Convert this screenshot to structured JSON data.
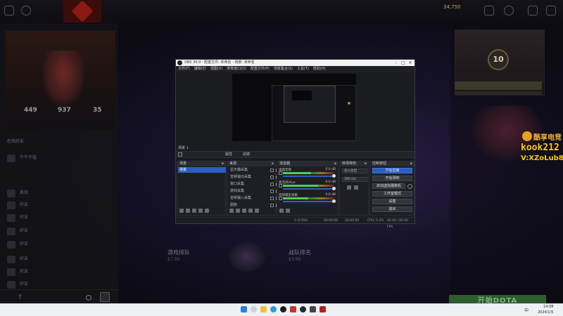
{
  "dota": {
    "gold": "34,750",
    "profile": {
      "name": "emt",
      "stats": [
        {
          "value": "449"
        },
        {
          "value": "937"
        },
        {
          "value": "35"
        }
      ]
    },
    "friends_header": "在线好友",
    "friends": [
      {
        "name": "牛牛不猛"
      },
      {
        "name": "离线"
      },
      {
        "name": "好友"
      },
      {
        "name": "好友"
      },
      {
        "name": "好友"
      },
      {
        "name": "好友"
      },
      {
        "name": "好友"
      },
      {
        "name": "好友"
      },
      {
        "name": "好友"
      }
    ],
    "right_level": "10",
    "promo_left_title": "游戏排队",
    "promo_left_value": "$7.99",
    "promo_right_title": "战队排名",
    "promo_right_value": "$3.99",
    "play_button": "开始DOTA"
  },
  "watermark": {
    "brand": "酷享电竞",
    "line1": "kook212",
    "line2": "V:XZoLub812"
  },
  "obs": {
    "title": "OBS 30.0 - 配置文件: 未命名 - 场景: 未命名",
    "menu": [
      "文件(F)",
      "编辑(E)",
      "视图(V)",
      "停靠窗口(D)",
      "配置文件(P)",
      "场景集合(S)",
      "工具(T)",
      "帮助(H)"
    ],
    "scene_label": "场景 1",
    "toolbar": {
      "properties": "属性",
      "filters": "滤镜"
    },
    "docks": {
      "scenes": "场景",
      "sources": "来源",
      "mixer": "混音器",
      "transitions": "转场特效",
      "controls": "控制按钮"
    },
    "scene_selected": "场景",
    "sources": [
      "显示器采集",
      "音频输出采集",
      "窗口采集",
      "游戏采集",
      "音频输入采集",
      "图像"
    ],
    "mixer": [
      {
        "name": "桌面音频",
        "db": "0.0 dB",
        "level": 0.55
      },
      {
        "name": "麦克风/Aux",
        "db": "0.0 dB",
        "level": 0.7
      },
      {
        "name": "音频输出采集",
        "db": "0.0 dB",
        "level": 0.5
      }
    ],
    "transitions": {
      "type": "淡入淡出",
      "duration": "300 ms"
    },
    "controls": [
      "开始直播",
      "开始录制",
      "启动虚拟摄像机",
      "工作室模式",
      "设置",
      "退出"
    ],
    "status": {
      "dropped": "0 (0.0%)",
      "live": "00:00:00",
      "rec": "00:00:00",
      "cpu": "CPU: 0.4%",
      "fps": "60.00 / 60.00 FPS"
    }
  },
  "taskbar": {
    "time": "14:08",
    "date": "2024/1/5",
    "lang": "中"
  }
}
